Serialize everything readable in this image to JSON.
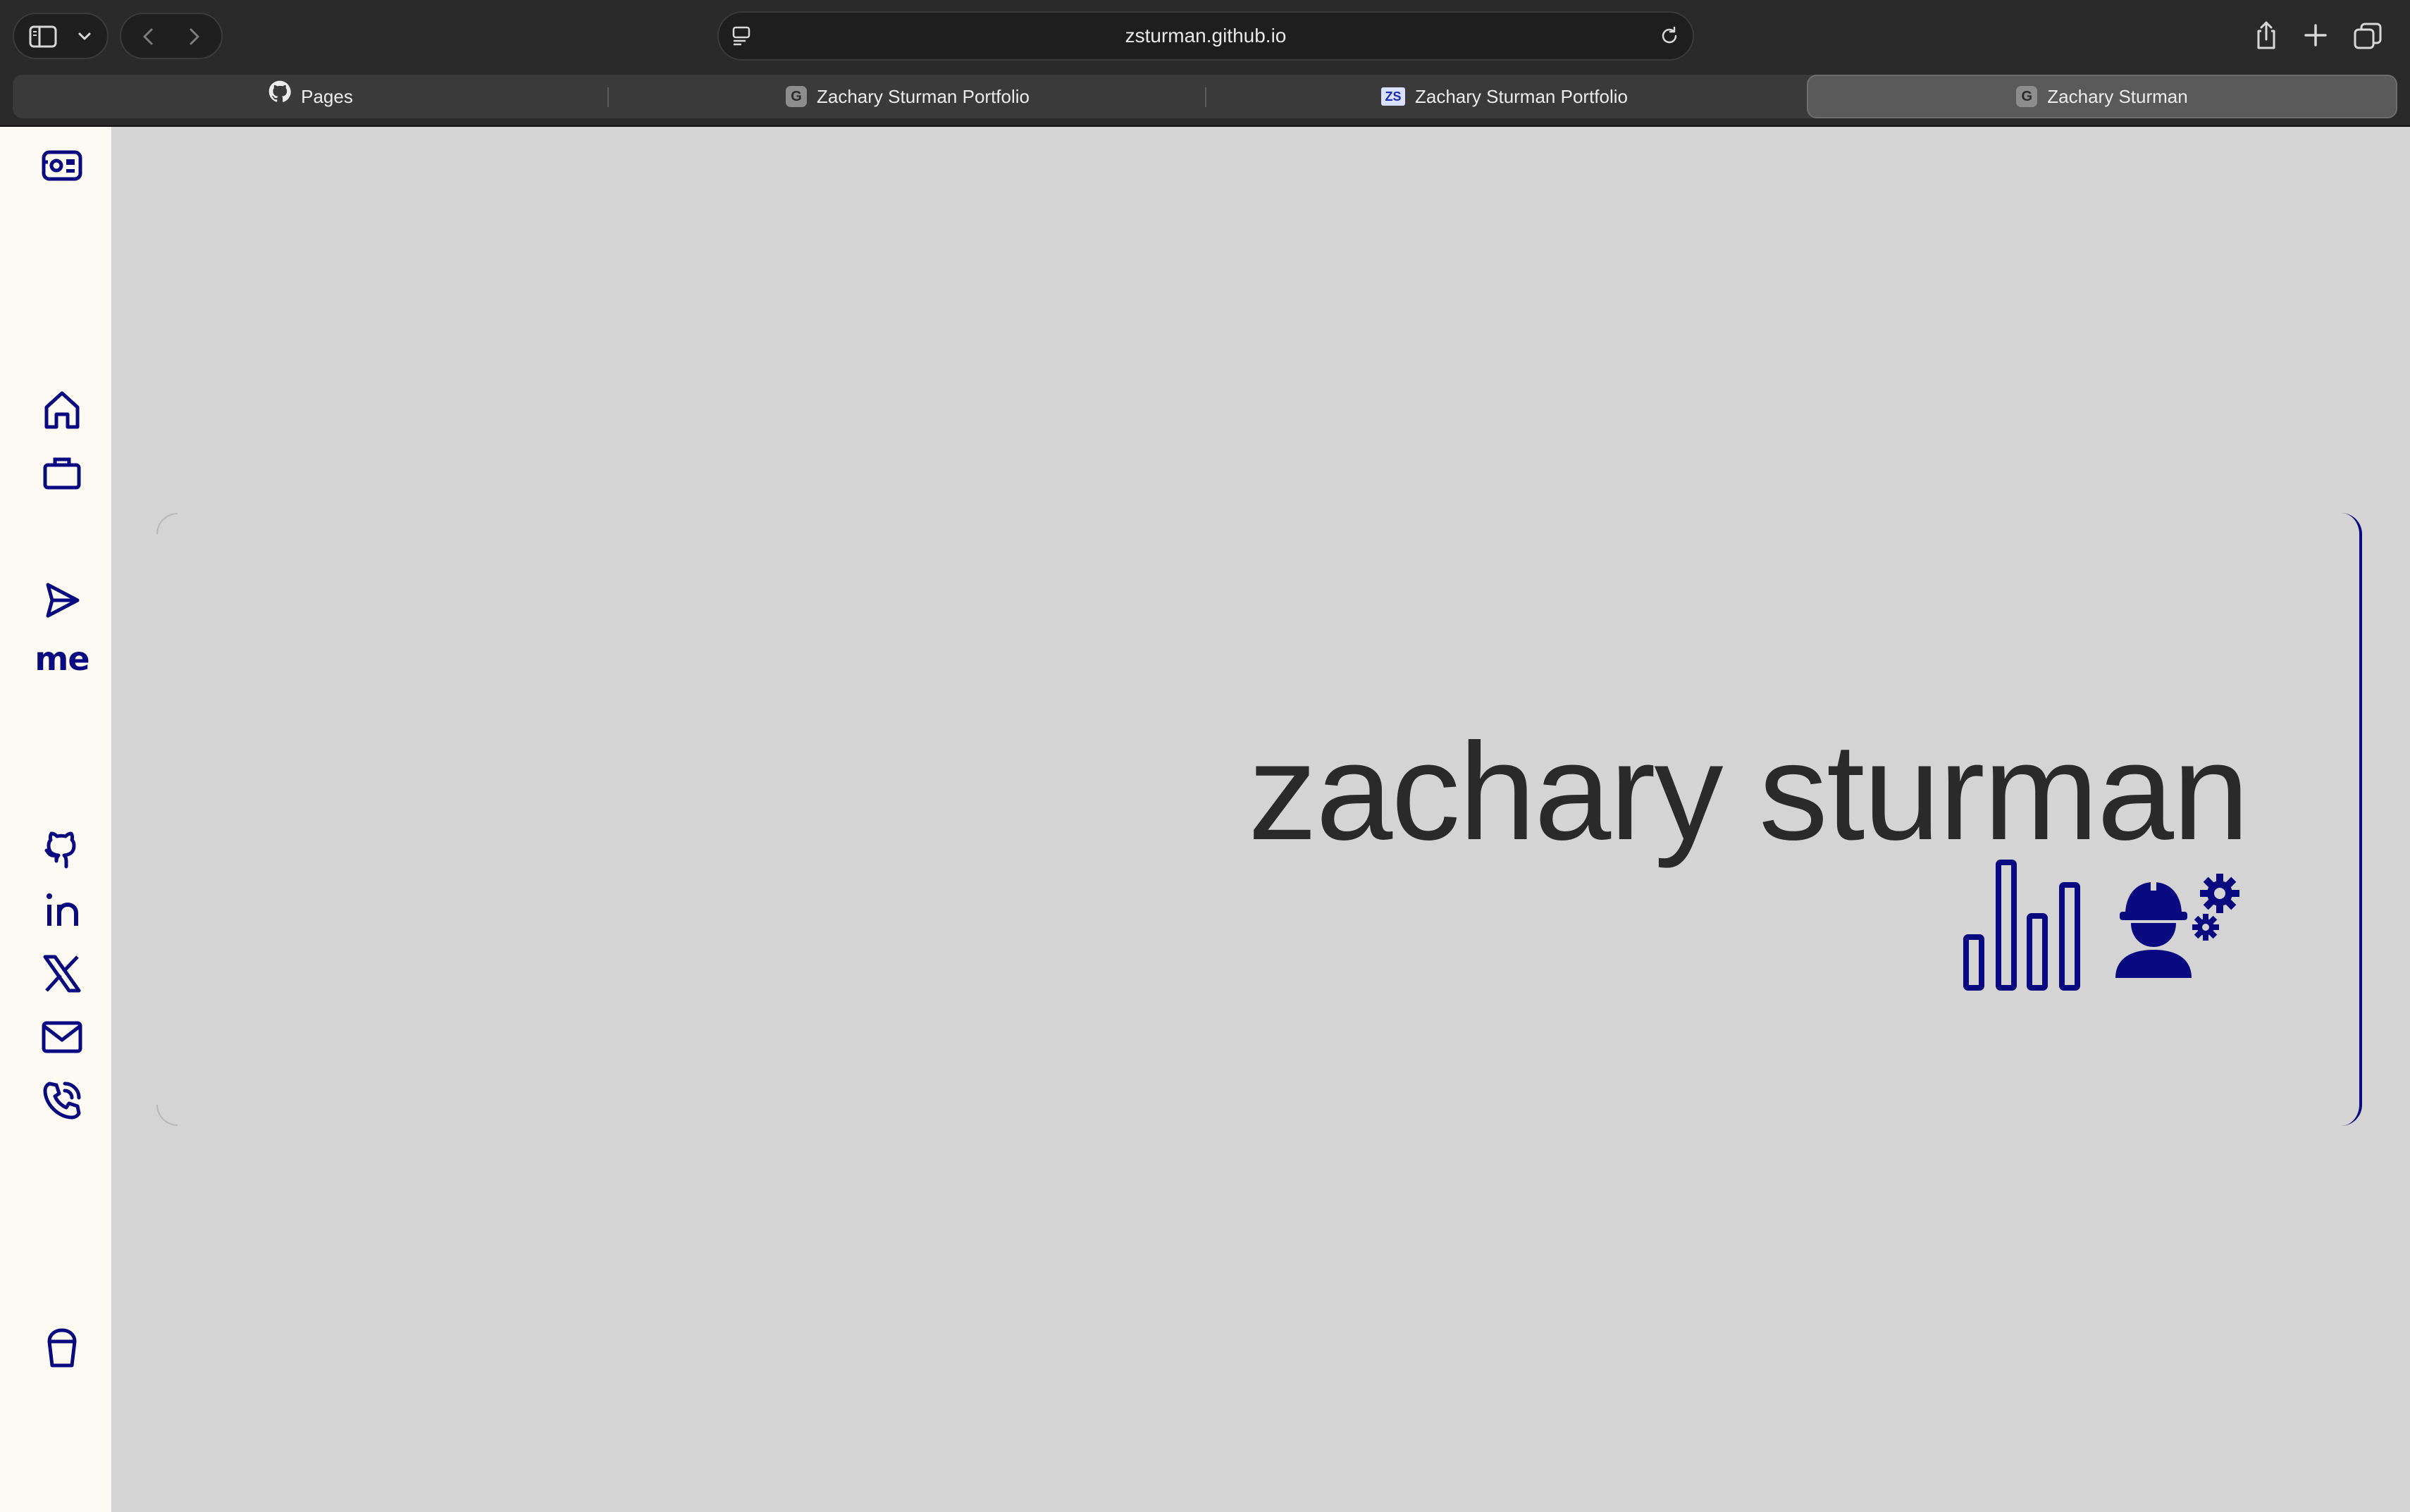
{
  "browser": {
    "url": "zsturman.github.io",
    "tabs": [
      {
        "label": "Pages",
        "favicon": "github-icon",
        "active": false
      },
      {
        "label": "Zachary Sturman Portfolio",
        "favicon": "letter-g-icon",
        "active": false
      },
      {
        "label": "Zachary Sturman Portfolio",
        "favicon": "zs-logo-icon",
        "active": false
      },
      {
        "label": "Zachary Sturman",
        "favicon": "letter-g-icon",
        "active": true
      }
    ],
    "favicon_letters": {
      "g": "G",
      "zs": "ZS"
    }
  },
  "sidebar": {
    "logo": "film-camera-icon",
    "nav": [
      {
        "name": "home",
        "icon": "home-icon"
      },
      {
        "name": "work",
        "icon": "briefcase-icon"
      },
      {
        "name": "about",
        "label": "me"
      },
      {
        "name": "contact",
        "icon": "send-icon"
      }
    ],
    "social": [
      "github-icon",
      "linkedin-icon",
      "x-icon",
      "mail-icon",
      "phone-icon"
    ],
    "footer": "bucket-icon"
  },
  "hero": {
    "name": "zachary sturman",
    "icons": [
      "bar-chart-icon",
      "engineer-gears-icon"
    ]
  },
  "colors": {
    "accent": "#0a0a80",
    "background": "#d4d4d4",
    "sidebar_bg": "#fdf9f3",
    "text": "#2a2a2a"
  }
}
